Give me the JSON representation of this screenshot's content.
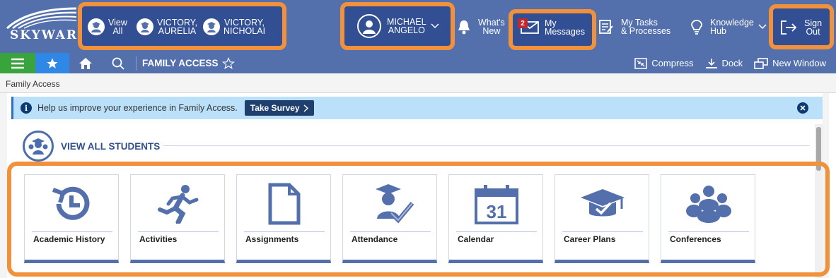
{
  "brand": {
    "logo_text": "SKYWARD"
  },
  "topbar": {
    "view_all": {
      "line1": "View",
      "line2": "All"
    },
    "students": [
      {
        "line1": "VICTORY,",
        "line2": "AURELIA"
      },
      {
        "line1": "VICTORY,",
        "line2": "NICHOLAI"
      }
    ],
    "user": {
      "line1": "MICHAEL",
      "line2": "ANGELO"
    },
    "whats_new": {
      "line1": "What's",
      "line2": "New"
    },
    "messages": {
      "line1": "My",
      "line2": "Messages",
      "badge": "2"
    },
    "tasks": {
      "line1": "My Tasks",
      "line2": "& Processes"
    },
    "knowledge": {
      "line1": "Knowledge",
      "line2": "Hub"
    },
    "sign_out": {
      "line1": "Sign",
      "line2": "Out"
    }
  },
  "navbar": {
    "title": "FAMILY ACCESS",
    "compress": "Compress",
    "dock": "Dock",
    "new_window": "New Window"
  },
  "breadcrumb": "Family Access",
  "survey": {
    "message": "Help us improve your experience in Family Access.",
    "button": "Take Survey"
  },
  "students_header": "VIEW ALL STUDENTS",
  "tiles": [
    {
      "label": "Academic History",
      "icon": "history-icon"
    },
    {
      "label": "Activities",
      "icon": "runner-icon"
    },
    {
      "label": "Assignments",
      "icon": "document-icon"
    },
    {
      "label": "Attendance",
      "icon": "graduate-check-icon"
    },
    {
      "label": "Calendar",
      "icon": "calendar-icon",
      "day": "31"
    },
    {
      "label": "Career Plans",
      "icon": "grad-cap-check-icon"
    },
    {
      "label": "Conferences",
      "icon": "group-icon"
    }
  ],
  "colors": {
    "header": "#5370ad",
    "highlight": "#f1913c",
    "menu_green": "#3aa43c",
    "star_blue": "#2f87e6",
    "survey_bg": "#bbe0f9"
  }
}
